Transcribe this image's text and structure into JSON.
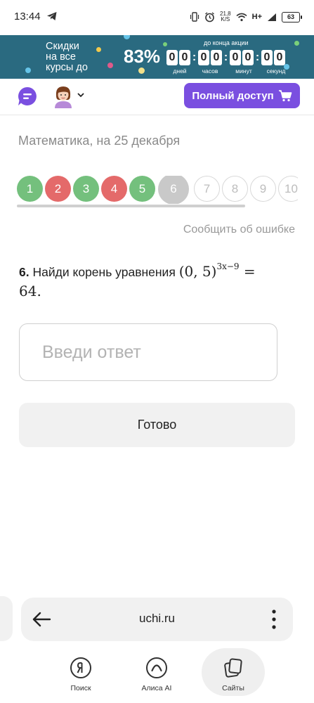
{
  "status_bar": {
    "time": "13:44",
    "speed_value": "21,8",
    "speed_unit": "K/S",
    "network": "H+",
    "battery": "63"
  },
  "promo": {
    "line1": "Скидки",
    "line2": "на все",
    "line3": "курсы до",
    "percent": "83%",
    "until_label": "до конца акции",
    "timer": {
      "days": [
        "0",
        "0"
      ],
      "hours": [
        "0",
        "0"
      ],
      "minutes": [
        "0",
        "0"
      ],
      "seconds": [
        "0",
        "0"
      ]
    },
    "labels": {
      "days": "дней",
      "hours": "часов",
      "minutes": "минут",
      "seconds": "секунд"
    }
  },
  "header": {
    "full_access_label": "Полный доступ",
    "accent_color": "#7a4fe0"
  },
  "subject_title": "Математика, на 25 декабря",
  "progress": {
    "items": [
      {
        "label": "1",
        "state": "correct"
      },
      {
        "label": "2",
        "state": "wrong"
      },
      {
        "label": "3",
        "state": "correct"
      },
      {
        "label": "4",
        "state": "wrong"
      },
      {
        "label": "5",
        "state": "correct"
      },
      {
        "label": "6",
        "state": "current"
      },
      {
        "label": "7",
        "state": "pending"
      },
      {
        "label": "8",
        "state": "pending"
      },
      {
        "label": "9",
        "state": "pending"
      },
      {
        "label": "10",
        "state": "pending"
      }
    ],
    "colors": {
      "correct": "#74c07d",
      "wrong": "#e46a6a",
      "current": "#c9c9c9"
    }
  },
  "report_link": "Сообщить об ошибке",
  "question": {
    "number": "6.",
    "text": "Найди корень уравнения",
    "math_base": "(0, 5)",
    "math_exp": "3x−9",
    "math_rhs": "=",
    "math_value": "64."
  },
  "answer": {
    "placeholder": "Введи ответ",
    "value": ""
  },
  "done_label": "Готово",
  "browser": {
    "url": "uchi.ru",
    "nav": [
      {
        "label": "Поиск",
        "icon": "yandex-icon"
      },
      {
        "label": "Алиса AI",
        "icon": "alice-icon"
      },
      {
        "label": "Сайты",
        "icon": "tabs-icon",
        "active": true
      }
    ]
  }
}
